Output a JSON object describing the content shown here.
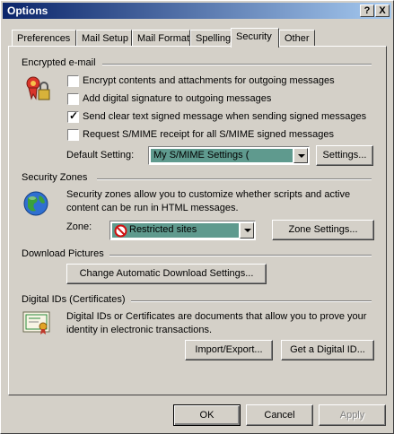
{
  "window": {
    "title": "Options",
    "help_glyph": "?",
    "close_glyph": "X"
  },
  "tabs": [
    {
      "label": "Preferences"
    },
    {
      "label": "Mail Setup"
    },
    {
      "label": "Mail Format"
    },
    {
      "label": "Spelling"
    },
    {
      "label": "Security",
      "active": true
    },
    {
      "label": "Other"
    }
  ],
  "encrypted": {
    "heading": "Encrypted e-mail",
    "options": [
      {
        "label": "Encrypt contents and attachments for outgoing messages",
        "checked": false
      },
      {
        "label": "Add digital signature to outgoing messages",
        "checked": false
      },
      {
        "label": "Send clear text signed message when sending signed messages",
        "checked": true
      },
      {
        "label": "Request S/MIME receipt for all S/MIME signed messages",
        "checked": false
      }
    ],
    "default_label": "Default Setting:",
    "default_value": "My S/MIME Settings (",
    "settings_button": "Settings..."
  },
  "zones": {
    "heading": "Security Zones",
    "description_1": "Security zones allow you to customize whether scripts and active",
    "description_2": "content can be run in HTML messages.",
    "zone_label": "Zone:",
    "zone_value": "Restricted sites",
    "zone_settings_button": "Zone Settings..."
  },
  "download": {
    "heading": "Download Pictures",
    "button": "Change Automatic Download Settings..."
  },
  "ids": {
    "heading": "Digital IDs (Certificates)",
    "description_1": "Digital IDs or Certificates are documents that allow you to prove your",
    "description_2": "identity in electronic transactions.",
    "import_button": "Import/Export...",
    "get_button": "Get a Digital ID..."
  },
  "footer": {
    "ok": "OK",
    "cancel": "Cancel",
    "apply": "Apply"
  },
  "colors": {
    "face": "#d4d0c8",
    "title_start": "#0a246a",
    "title_end": "#a6caf0",
    "combo_highlight": "#5f9a8e"
  },
  "icons": [
    "certificate-lock-icon",
    "globe-icon",
    "restricted-sites-icon",
    "digital-id-certificate-icon"
  ]
}
